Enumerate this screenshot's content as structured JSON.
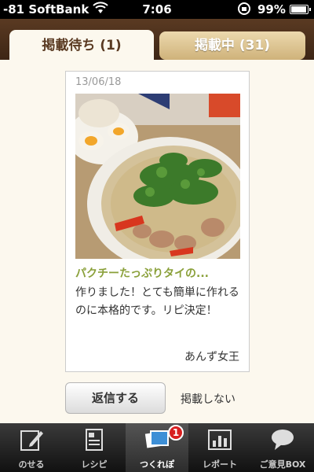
{
  "status_bar": {
    "carrier": "-81 SoftBank",
    "time": "7:06",
    "battery": "99%"
  },
  "tabs": [
    {
      "label": "掲載待ち (1)",
      "active": true
    },
    {
      "label": "掲載中 (31)",
      "active": false
    }
  ],
  "card": {
    "date": "13/06/18",
    "dish_title": "パクチーたっぷりタイの...",
    "comment": "作りました！とても簡単に作れるのに本格的です。リピ決定！",
    "author": "あんず女王"
  },
  "actions": {
    "reply_label": "返信する",
    "hide_label": "掲載しない"
  },
  "bottom_nav": {
    "items": [
      {
        "label": "のせる",
        "icon": "pencil-icon"
      },
      {
        "label": "レシピ",
        "icon": "recipe-icon"
      },
      {
        "label": "つくれぽ",
        "icon": "photo-icon",
        "badge": "1",
        "selected": true
      },
      {
        "label": "レポート",
        "icon": "report-chart-icon"
      },
      {
        "label": "ご意見BOX",
        "icon": "speech-bubble-icon"
      }
    ]
  },
  "colors": {
    "header_brown": "#5a3a22",
    "title_green": "#8aa03a",
    "badge_red": "#d81f1f"
  }
}
